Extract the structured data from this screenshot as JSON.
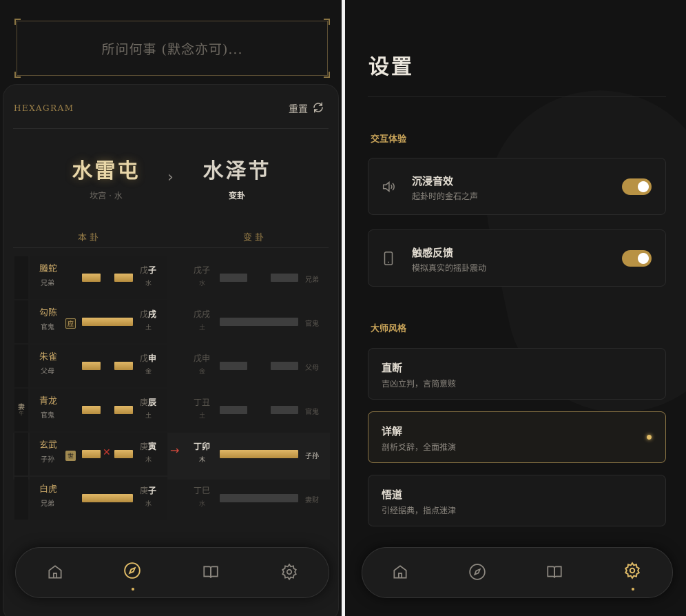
{
  "left": {
    "question_placeholder": "所问何事 (默念亦可)...",
    "card": {
      "section_label": "HEXAGRAM",
      "reset_label": "重置",
      "original": {
        "name": "水雷屯",
        "sub": "坎宫 · 水"
      },
      "changed": {
        "name": "水泽节",
        "sub": "变卦"
      },
      "col_original": "本卦",
      "col_changed": "变卦"
    },
    "lines": [
      {
        "beast": "螣蛇",
        "relation": "兄弟",
        "stem_dim": "戊",
        "stem": "子",
        "element": "水",
        "badge": "",
        "changed_stem_dim": "戊",
        "changed_stem": "子",
        "changed_element": "水",
        "changed_relation": "兄弟",
        "yin": true,
        "changed_yin": true,
        "moving": false
      },
      {
        "beast": "勾陈",
        "relation": "官鬼",
        "stem_dim": "戊",
        "stem": "戌",
        "element": "土",
        "badge": "应",
        "changed_stem_dim": "戊",
        "changed_stem": "戌",
        "changed_element": "土",
        "changed_relation": "官鬼",
        "yin": false,
        "changed_yin": false,
        "moving": false
      },
      {
        "beast": "朱雀",
        "relation": "父母",
        "stem_dim": "戊",
        "stem": "申",
        "element": "金",
        "badge": "",
        "changed_stem_dim": "戊",
        "changed_stem": "申",
        "changed_element": "金",
        "changed_relation": "父母",
        "yin": true,
        "changed_yin": true,
        "moving": false
      },
      {
        "beast": "青龙",
        "relation": "官鬼",
        "stem_dim": "庚",
        "stem": "辰",
        "element": "土",
        "badge": "",
        "changed_stem_dim": "丁",
        "changed_stem": "丑",
        "changed_element": "土",
        "changed_relation": "官鬼",
        "yin": true,
        "changed_yin": true,
        "moving": false,
        "side_label": "妻",
        "side_sub": "午"
      },
      {
        "beast": "玄武",
        "relation": "子孙",
        "stem_dim": "庚",
        "stem": "寅",
        "element": "木",
        "badge": "世",
        "changed_stem_dim": "丁",
        "changed_stem": "卯",
        "changed_element": "木",
        "changed_relation": "子孙",
        "yin": true,
        "changed_yin": false,
        "moving": true
      },
      {
        "beast": "白虎",
        "relation": "兄弟",
        "stem_dim": "庚",
        "stem": "子",
        "element": "水",
        "badge": "",
        "changed_stem_dim": "丁",
        "changed_stem": "巳",
        "changed_element": "水",
        "changed_relation": "妻财",
        "yin": false,
        "changed_yin": false,
        "moving": false
      }
    ],
    "nav": [
      {
        "icon": "home-icon",
        "active": false
      },
      {
        "icon": "compass-icon",
        "active": true
      },
      {
        "icon": "book-icon",
        "active": false
      },
      {
        "icon": "gear-icon",
        "active": false
      }
    ]
  },
  "right": {
    "title": "设置",
    "section_interaction": "交互体验",
    "sound": {
      "name": "沉浸音效",
      "desc": "起卦时的金石之声",
      "enabled": true
    },
    "haptic": {
      "name": "触感反馈",
      "desc": "模拟真实的摇卦震动",
      "enabled": true
    },
    "section_style": "大师风格",
    "styles": [
      {
        "name": "直断",
        "desc": "吉凶立判，言简意赅",
        "selected": false
      },
      {
        "name": "详解",
        "desc": "剖析爻辞，全面推演",
        "selected": true
      },
      {
        "name": "悟道",
        "desc": "引经据典，指点迷津",
        "selected": false
      }
    ],
    "nav": [
      {
        "icon": "home-icon",
        "active": false
      },
      {
        "icon": "compass-icon",
        "active": false
      },
      {
        "icon": "book-icon",
        "active": false
      },
      {
        "icon": "gear-icon",
        "active": true
      }
    ],
    "colors": {
      "gold": "#d8b25c",
      "toggle": "#b89244"
    }
  }
}
